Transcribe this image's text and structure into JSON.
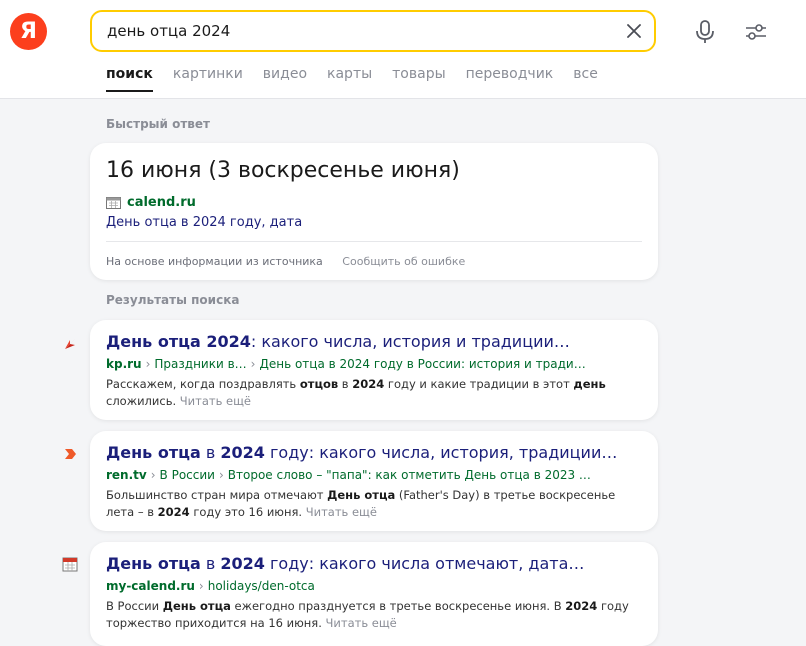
{
  "header": {
    "logo": "Я",
    "search": {
      "value": "день отца 2024",
      "placeholder": ""
    },
    "tabs": [
      {
        "label": "поиск",
        "active": true
      },
      {
        "label": "картинки"
      },
      {
        "label": "видео"
      },
      {
        "label": "карты"
      },
      {
        "label": "товары"
      },
      {
        "label": "переводчик"
      },
      {
        "label": "все"
      }
    ]
  },
  "quick_answer": {
    "section_label": "Быстрый ответ",
    "title": "16 июня (3 воскресенье июня)",
    "source_site": "calend.ru",
    "source_title": "День отца в 2024 году, дата",
    "footer_info": "На основе информации из источника",
    "footer_report": "Сообщить об ошибке"
  },
  "results": {
    "section_label": "Результаты поиска",
    "more_label": "Читать ещё",
    "items": [
      {
        "favicon": "kp-icon",
        "title": [
          {
            "t": "День отца 2024",
            "b": true
          },
          {
            "t": ": какого числа, история и традиции…"
          }
        ],
        "domain": "kp.ru",
        "path": [
          "Праздники в…",
          "День отца в 2024 году в России: история и тради…"
        ],
        "snippet": [
          {
            "t": "Расскажем, когда поздравлять "
          },
          {
            "t": "отцов",
            "b": true
          },
          {
            "t": " в "
          },
          {
            "t": "2024",
            "b": true
          },
          {
            "t": " году и какие традиции в этот "
          },
          {
            "t": "день",
            "b": true
          },
          {
            "t": " сложились. "
          }
        ]
      },
      {
        "favicon": "ren-tv-icon",
        "title": [
          {
            "t": "День отца",
            "b": true
          },
          {
            "t": " в "
          },
          {
            "t": "2024",
            "b": true
          },
          {
            "t": " году: какого числа, история, традиции…"
          }
        ],
        "domain": "ren.tv",
        "path": [
          "В России",
          "Второе слово – \"папа\": как отметить День отца в 2023 …"
        ],
        "snippet": [
          {
            "t": "Большинство стран мира отмечают "
          },
          {
            "t": "День отца",
            "b": true
          },
          {
            "t": " (Father's Day) в третье воскресенье лета – в "
          },
          {
            "t": "2024",
            "b": true
          },
          {
            "t": " году это 16 июня. "
          }
        ]
      },
      {
        "favicon": "calendar-icon",
        "title": [
          {
            "t": "День отца",
            "b": true
          },
          {
            "t": " в "
          },
          {
            "t": "2024",
            "b": true
          },
          {
            "t": " году: какого числа отмечают, дата…"
          }
        ],
        "domain": "my-calend.ru",
        "path": [
          "holidays/den-otca"
        ],
        "snippet": [
          {
            "t": "В России "
          },
          {
            "t": "День отца",
            "b": true
          },
          {
            "t": " ежегодно празднуется в третье воскресенье июня. В "
          },
          {
            "t": "2024",
            "b": true
          },
          {
            "t": " году торжество приходится на 16 июня. "
          }
        ]
      }
    ]
  },
  "colors": {
    "brand": "#fc3f1d",
    "search_border": "#ffcc00",
    "link": "#1b1f7a",
    "url_green": "#006b2c",
    "muted": "#8a8d96",
    "page_bg": "#f4f5f7"
  }
}
